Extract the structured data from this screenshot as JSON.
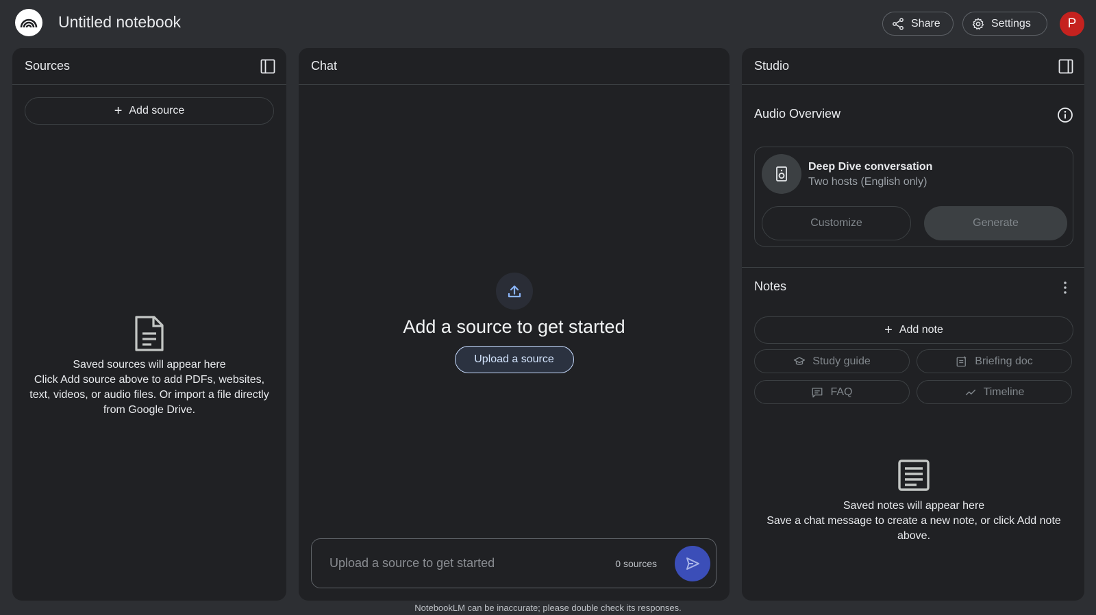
{
  "header": {
    "notebook_title": "Untitled notebook",
    "share_label": "Share",
    "settings_label": "Settings",
    "avatar_initial": "P"
  },
  "sources": {
    "title": "Sources",
    "add_source_label": "Add source",
    "empty_title": "Saved sources will appear here",
    "empty_body": "Click Add source above to add PDFs, websites, text, videos, or audio files. Or import a file directly from Google Drive."
  },
  "chat": {
    "title": "Chat",
    "heading": "Add a source to get started",
    "upload_label": "Upload a source",
    "input_placeholder": "Upload a source to get started",
    "source_count": "0 sources"
  },
  "studio": {
    "title": "Studio",
    "audio_overview_title": "Audio Overview",
    "card_title": "Deep Dive conversation",
    "card_subtitle": "Two hosts (English only)",
    "customize_label": "Customize",
    "generate_label": "Generate",
    "notes_title": "Notes",
    "add_note_label": "Add note",
    "chips": {
      "study_guide": "Study guide",
      "briefing_doc": "Briefing doc",
      "faq": "FAQ",
      "timeline": "Timeline"
    },
    "notes_empty_title": "Saved notes will appear here",
    "notes_empty_body": "Save a chat message to create a new note, or click Add note above."
  },
  "footer": {
    "disclaimer": "NotebookLM can be inaccurate; please double check its responses."
  },
  "colors": {
    "background": "#2d2f33",
    "panel": "#202124",
    "accent_send": "#3b4eb8",
    "avatar": "#c5221f",
    "upload_border": "#c6dafc"
  }
}
